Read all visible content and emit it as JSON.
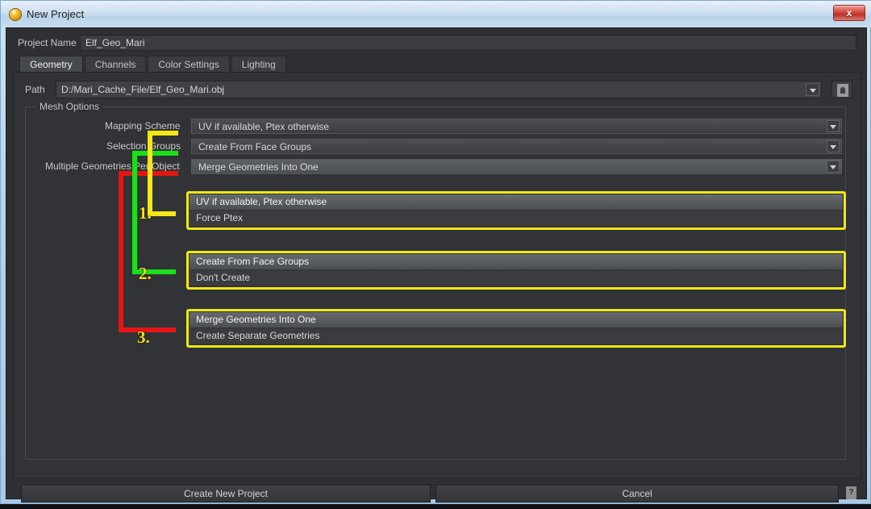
{
  "window": {
    "title": "New Project",
    "icon": "mari-logo-icon",
    "close_label": "x"
  },
  "project_name": {
    "label": "Project Name",
    "value": "Elf_Geo_Mari"
  },
  "tabs": [
    {
      "label": "Geometry",
      "active": true
    },
    {
      "label": "Channels",
      "active": false
    },
    {
      "label": "Color Settings",
      "active": false
    },
    {
      "label": "Lighting",
      "active": false
    }
  ],
  "path": {
    "label": "Path",
    "value": "D:/Mari_Cache_File/Elf_Geo_Mari.obj",
    "browse_icon": "folder-open-icon"
  },
  "mesh_options": {
    "title": "Mesh Options",
    "rows": [
      {
        "label": "Mapping Scheme",
        "value": "UV if available, Ptex otherwise",
        "highlighted": false
      },
      {
        "label": "Selection Groups",
        "value": "Create From Face Groups",
        "highlighted": false
      },
      {
        "label": "Multiple Geometries Per Object",
        "value": "Merge Geometries Into One",
        "highlighted": true
      }
    ]
  },
  "popups": [
    {
      "number": "1.",
      "items": [
        {
          "label": "UV if available, Ptex otherwise",
          "selected": true
        },
        {
          "label": "Force Ptex",
          "selected": false
        }
      ]
    },
    {
      "number": "2.",
      "items": [
        {
          "label": "Create From Face Groups",
          "selected": true
        },
        {
          "label": "Don't Create",
          "selected": false
        }
      ]
    },
    {
      "number": "3.",
      "items": [
        {
          "label": "Merge Geometries Into One",
          "selected": true
        },
        {
          "label": "Create Separate Geometries",
          "selected": false
        }
      ]
    }
  ],
  "annotation_colors": {
    "callout_1": "#f2e814",
    "callout_2": "#19e019",
    "callout_3": "#e81414",
    "popup_border": "#f2e814"
  },
  "footer": {
    "create_label": "Create New Project",
    "cancel_label": "Cancel",
    "help_label": "?"
  }
}
